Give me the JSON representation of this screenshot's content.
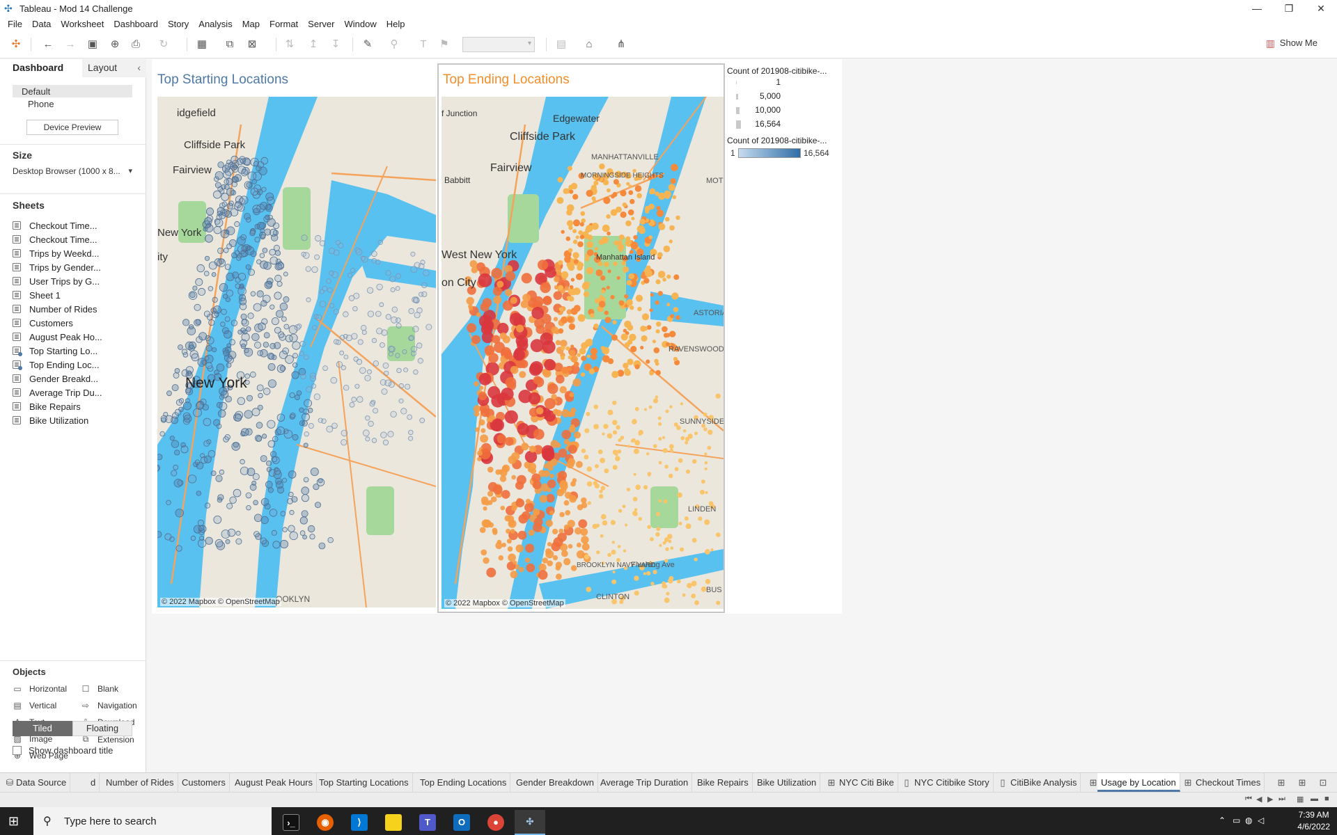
{
  "window": {
    "title": "Tableau - Mod 14 Challenge"
  },
  "menu": [
    "File",
    "Data",
    "Worksheet",
    "Dashboard",
    "Story",
    "Analysis",
    "Map",
    "Format",
    "Server",
    "Window",
    "Help"
  ],
  "toolbar": {
    "show_me_label": "Show Me"
  },
  "left_panel": {
    "tab_dashboard": "Dashboard",
    "tab_layout": "Layout",
    "devices": [
      "Default",
      "Phone"
    ],
    "device_preview_label": "Device Preview",
    "size_heading": "Size",
    "size_value": "Desktop Browser (1000 x 8...",
    "sheets_heading": "Sheets",
    "sheets": [
      "Checkout Time...",
      "Checkout Time...",
      "Trips by Weekd...",
      "Trips by Gender...",
      "User Trips by G...",
      "Sheet 1",
      "Number of Rides",
      "Customers",
      "August Peak Ho...",
      "Top Starting Lo...",
      "Top Ending Loc...",
      "Gender Breakd...",
      "Average Trip Du...",
      "Bike Repairs",
      "Bike Utilization"
    ],
    "objects_heading": "Objects",
    "objects": [
      {
        "label": "Horizontal",
        "icon": "horizontal-icon"
      },
      {
        "label": "Blank",
        "icon": "blank-icon"
      },
      {
        "label": "Vertical",
        "icon": "vertical-icon"
      },
      {
        "label": "Navigation",
        "icon": "navigation-icon"
      },
      {
        "label": "Text",
        "icon": "text-icon"
      },
      {
        "label": "Download",
        "icon": "download-icon"
      },
      {
        "label": "Image",
        "icon": "image-icon"
      },
      {
        "label": "Extension",
        "icon": "extension-icon"
      },
      {
        "label": "Web Page",
        "icon": "web-page-icon"
      }
    ],
    "tiled_label": "Tiled",
    "floating_label": "Floating",
    "show_title_label": "Show dashboard title"
  },
  "dashboard": {
    "start_title": "Top Starting Locations",
    "end_title": "Top Ending Locations",
    "start_title_color": "#4e79a7",
    "end_title_color": "#f28e2b",
    "attribution": "© 2022 Mapbox © OpenStreetMap",
    "start_map_labels": [
      "idgefield",
      "Cliffside Park",
      "Fairview",
      "New York",
      "ity",
      "New York",
      "OOKLYN"
    ],
    "end_map_labels": [
      "f Junction",
      "Edgewater",
      "Cliffside Park",
      "Fairview",
      "MANHATTANVILLE",
      "MORNINGSIDE HEIGHTS",
      "Babbitt",
      "West New York",
      "on City",
      "Manhattan Island",
      "ASTORIA",
      "RAVENSWOOD",
      "SUNNYSIDE",
      "LINDEN",
      "BROOKLYN NAVY YARD",
      "Flushing Ave",
      "CLINTON",
      "BUS",
      "MOT"
    ],
    "legend_size_title": "Count of 201908-citibike-...",
    "legend_size_values": [
      "1",
      "5,000",
      "10,000",
      "16,564"
    ],
    "legend_color_title": "Count of 201908-citibike-...",
    "legend_color_min": "1",
    "legend_color_max": "16,564"
  },
  "tabs": [
    {
      "label": "Data Source",
      "icon": "database-icon"
    },
    {
      "label": "d"
    },
    {
      "label": "Number of Rides"
    },
    {
      "label": "Customers"
    },
    {
      "label": "August Peak Hours"
    },
    {
      "label": "Top Starting Locations"
    },
    {
      "label": "Top Ending Locations"
    },
    {
      "label": "Gender Breakdown"
    },
    {
      "label": "Average Trip Duration"
    },
    {
      "label": "Bike Repairs"
    },
    {
      "label": "Bike Utilization"
    },
    {
      "label": "NYC Citi Bike",
      "icon": "dashboard-icon"
    },
    {
      "label": "NYC Citibike Story",
      "icon": "story-icon"
    },
    {
      "label": "CitiBike Analysis",
      "icon": "story-icon"
    },
    {
      "label": "Usage by Location",
      "icon": "dashboard-icon",
      "active": true
    },
    {
      "label": "Checkout Times",
      "icon": "dashboard-icon"
    }
  ],
  "taskbar": {
    "search_placeholder": "Type here to search",
    "time": "7:39 AM",
    "date": "4/6/2022"
  }
}
